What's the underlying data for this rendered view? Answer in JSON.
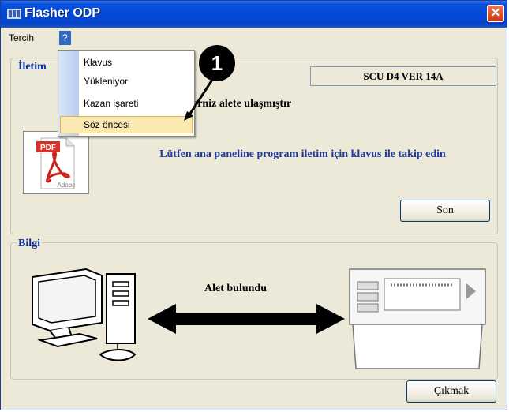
{
  "window": {
    "title": "Flasher ODP",
    "close_glyph": "✕"
  },
  "menubar": {
    "items": [
      {
        "label": "Tercih"
      },
      {
        "label": "?"
      }
    ]
  },
  "dropdown": {
    "items": [
      {
        "label": "Klavus"
      },
      {
        "label": "Yükleniyor"
      },
      {
        "label": "Kazan işareti"
      },
      {
        "label": "Söz öncesi",
        "highlighted": true
      }
    ]
  },
  "callout": {
    "label": "1"
  },
  "iletisim": {
    "group_title": "İletim",
    "version": "SCU D4 VER 14A",
    "message_reached": "erniz alete ulaşmıştır",
    "message_instruction": "Lütfen ana paneline program iletim için klavus ile takip edin",
    "son_button": "Son",
    "pdf_icon": {
      "icon": "pdf-adobe-icon",
      "badge": "PDF",
      "brand": "Adobe"
    }
  },
  "bilgi": {
    "group_title": "Bilgi",
    "device_found": "Alet bulundu",
    "computer_icon": "computer-icon",
    "device_icon": "control-panel-icon",
    "arrow_icon": "double-arrow-icon"
  },
  "footer": {
    "exit_button": "Çıkmak"
  },
  "colors": {
    "title_bar": "#0349d6",
    "menu_highlight": "#316ac5",
    "group_title": "#0a2f9d",
    "instruction_text": "#1d3a9e",
    "dropdown_hover": "#fbe9b2"
  }
}
